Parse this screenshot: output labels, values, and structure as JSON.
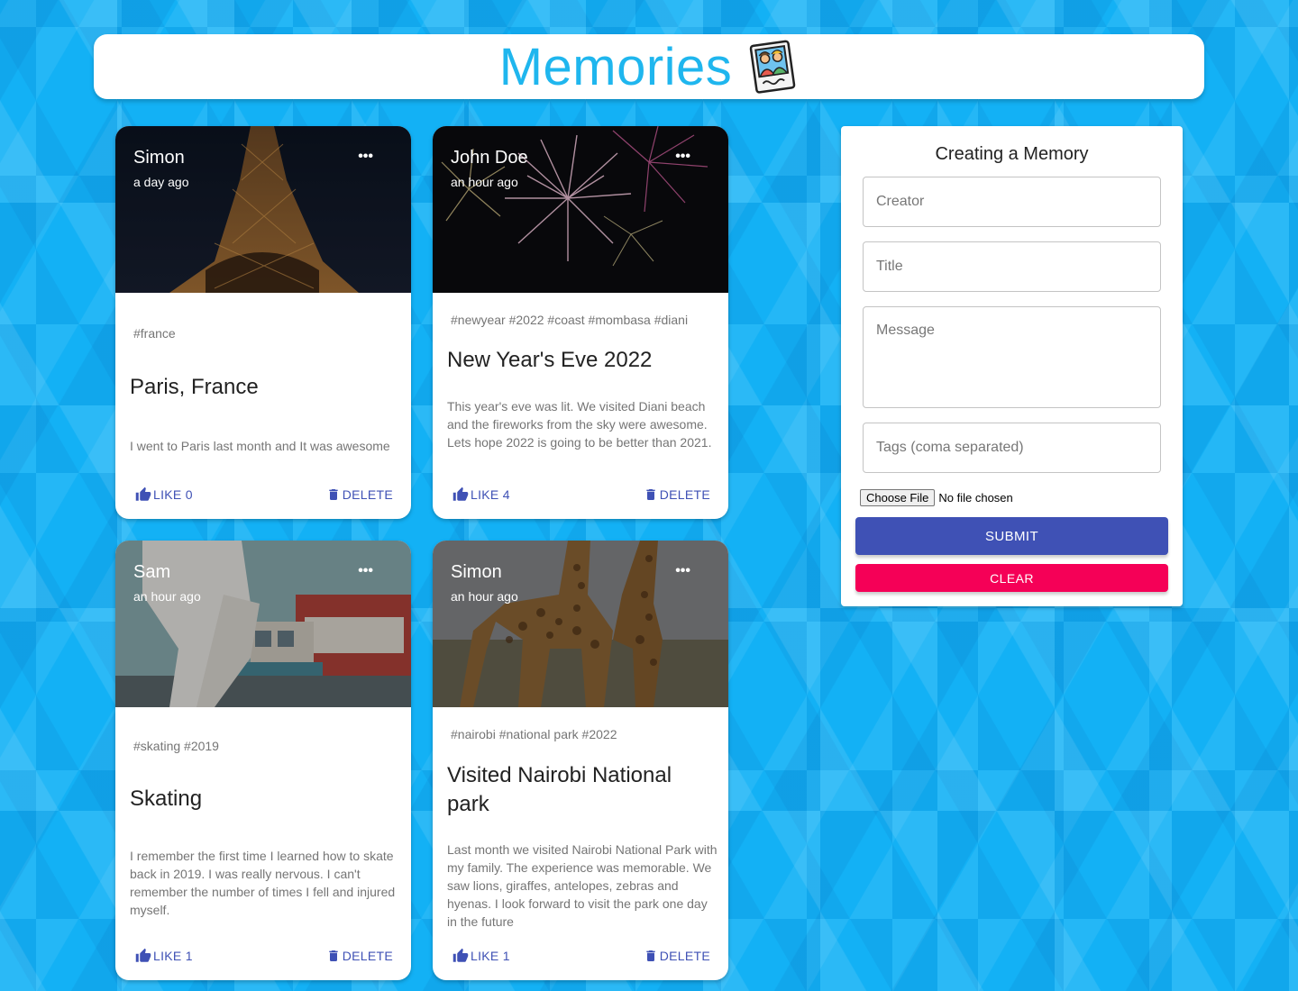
{
  "app": {
    "title": "Memories"
  },
  "posts": [
    {
      "creator": "Simon",
      "time": "a day ago",
      "tags": "#france",
      "title": "Paris, France",
      "message": "I went to Paris last month and It was awesome",
      "like_label": "LIKE 0",
      "delete_label": "DELETE",
      "image_subject": "eiffel-tower-at-night"
    },
    {
      "creator": "John Doe",
      "time": "an hour ago",
      "tags": "#newyear #2022 #coast #mombasa #diani",
      "title": "New Year's Eve 2022",
      "message": "This year's eve was lit. We visited Diani beach and the fireworks from the sky were awesome. Lets hope 2022 is going to be better than 2021.",
      "like_label": "LIKE 4",
      "delete_label": "DELETE",
      "image_subject": "fireworks"
    },
    {
      "creator": "Sam",
      "time": "an hour ago",
      "tags": "#skating #2019",
      "title": "Skating",
      "message": "I remember the first time I learned how to skate back in 2019. I was really nervous. I can't remember the number of times I fell and injured myself.",
      "like_label": "LIKE 1",
      "delete_label": "DELETE",
      "image_subject": "skater-on-street"
    },
    {
      "creator": "Simon",
      "time": "an hour ago",
      "tags": "#nairobi #national park #2022",
      "title": "Visited Nairobi National park",
      "message": "Last month we visited Nairobi National Park with my family. The experience was memorable. We saw lions, giraffes, antelopes, zebras and hyenas. I look forward to visit the park one day in the future",
      "like_label": "LIKE 1",
      "delete_label": "DELETE",
      "image_subject": "giraffes"
    }
  ],
  "form": {
    "heading": "Creating a Memory",
    "creator_placeholder": "Creator",
    "title_placeholder": "Title",
    "message_placeholder": "Message",
    "tags_placeholder": "Tags (coma separated)",
    "file_button": "Choose File",
    "file_status": "No file chosen",
    "submit_label": "SUBMIT",
    "clear_label": "CLEAR"
  },
  "colors": {
    "background": "#13b1f5",
    "title": "#1fb6ee",
    "primary": "#3f51b5",
    "secondary": "#f50057"
  },
  "icons": [
    "memories-logo-icon",
    "more-horiz-icon",
    "thumb-up-icon",
    "delete-icon"
  ]
}
